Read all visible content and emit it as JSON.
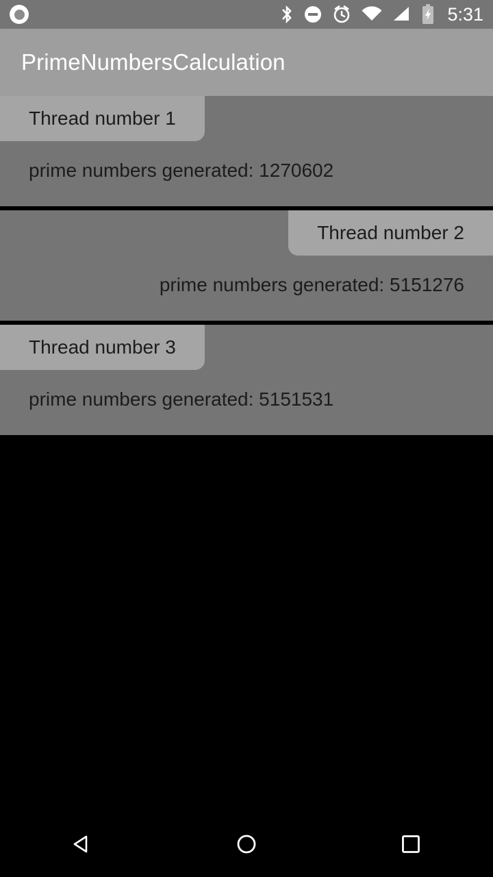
{
  "status_bar": {
    "notification_icon": "circle-notification-icon",
    "icons": [
      "bluetooth-icon",
      "do-not-disturb-icon",
      "alarm-clock-icon",
      "wifi-icon",
      "cellular-signal-icon",
      "battery-charging-icon"
    ],
    "time": "5:31",
    "background_color": "#757575",
    "foreground_color": "#ffffff"
  },
  "app_bar": {
    "title": "PrimeNumbersCalculation",
    "background_color": "#9e9e9e",
    "title_color": "#ffffff"
  },
  "main": {
    "background_color": "#757575",
    "chip_color": "#a5a5a5",
    "text_color": "#1c1c1c",
    "divider_color": "#000000",
    "threads": [
      {
        "label": "Thread number 1",
        "count_text": "prime numbers generated: 1270602",
        "count_value": 1270602,
        "align": "left"
      },
      {
        "label": "Thread number 2",
        "count_text": "prime numbers generated: 5151276",
        "count_value": 5151276,
        "align": "right"
      },
      {
        "label": "Thread number 3",
        "count_text": "prime numbers generated: 5151531",
        "count_value": 5151531,
        "align": "left"
      }
    ]
  },
  "nav_bar": {
    "background_color": "#000000",
    "buttons": [
      {
        "name": "back-button",
        "icon": "back-triangle-icon"
      },
      {
        "name": "home-button",
        "icon": "home-circle-icon"
      },
      {
        "name": "recents-button",
        "icon": "recents-square-icon"
      }
    ]
  }
}
